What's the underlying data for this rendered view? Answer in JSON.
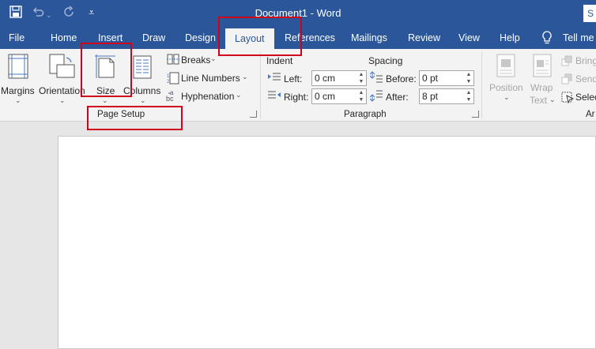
{
  "titlebar": {
    "title": "Document1 - Word",
    "search_stub": "S",
    "quick_access": [
      "save-icon",
      "undo-icon",
      "redo-icon",
      "customize-icon"
    ]
  },
  "tabs": [
    {
      "label": "File"
    },
    {
      "label": "Home"
    },
    {
      "label": "Insert"
    },
    {
      "label": "Draw"
    },
    {
      "label": "Design"
    },
    {
      "label": "Layout",
      "active": true
    },
    {
      "label": "References"
    },
    {
      "label": "Mailings"
    },
    {
      "label": "Review"
    },
    {
      "label": "View"
    },
    {
      "label": "Help"
    }
  ],
  "tell_me": "Tell me w",
  "page_setup": {
    "margins": "Margins",
    "orientation": "Orientation",
    "size": "Size",
    "columns": "Columns",
    "breaks": "Breaks",
    "line_numbers": "Line Numbers",
    "hyphenation": "Hyphenation",
    "group_label": "Page Setup"
  },
  "paragraph": {
    "indent_header": "Indent",
    "spacing_header": "Spacing",
    "left_label": "Left:",
    "left_value": "0 cm",
    "right_label": "Right:",
    "right_value": "0 cm",
    "before_label": "Before:",
    "before_value": "0 pt",
    "after_label": "After:",
    "after_value": "8 pt",
    "group_label": "Paragraph"
  },
  "arrange": {
    "position": "Position",
    "wrap": "Wrap",
    "wrap2": "Text",
    "bring": "Bring",
    "send": "Send",
    "select": "Selec",
    "group_label_stub": "Ar"
  },
  "colors": {
    "brand": "#2b579a",
    "highlight": "#d0021b"
  }
}
